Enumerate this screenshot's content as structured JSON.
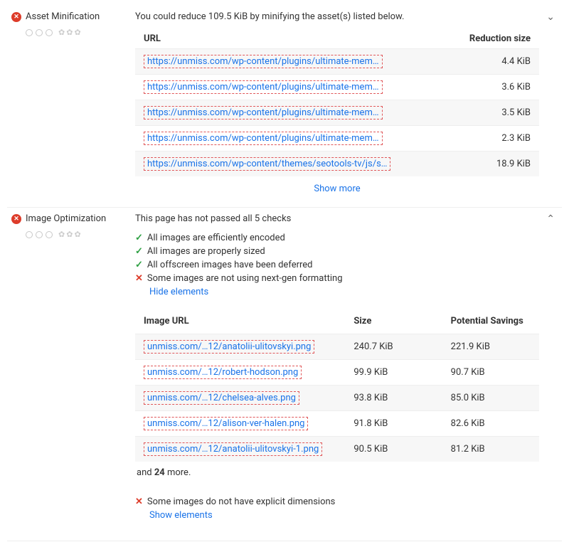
{
  "sections": {
    "minification": {
      "title": "Asset Minification",
      "summary": "You could reduce 109.5 KiB by minifying the asset(s) listed below.",
      "headers": {
        "url": "URL",
        "reduction": "Reduction size"
      },
      "rows": [
        {
          "url": "https://unmiss.com/wp-content/plugins/ultimate-mem…",
          "reduction": "4.4 KiB"
        },
        {
          "url": "https://unmiss.com/wp-content/plugins/ultimate-mem…",
          "reduction": "3.6 KiB"
        },
        {
          "url": "https://unmiss.com/wp-content/plugins/ultimate-mem…",
          "reduction": "3.5 KiB"
        },
        {
          "url": "https://unmiss.com/wp-content/plugins/ultimate-mem…",
          "reduction": "2.3 KiB"
        },
        {
          "url": "https://unmiss.com/wp-content/themes/seotools-tv/js/s…",
          "reduction": "18.9 KiB"
        }
      ],
      "show_more": "Show more"
    },
    "image_opt": {
      "title": "Image Optimization",
      "summary": "This page has not passed all 5 checks",
      "checks": [
        {
          "icon": "check",
          "text": "All images are efficiently encoded"
        },
        {
          "icon": "check",
          "text": "All images are properly sized"
        },
        {
          "icon": "check",
          "text": "All offscreen images have been deferred"
        },
        {
          "icon": "x",
          "text": "Some images are not using next-gen formatting"
        }
      ],
      "hide_elements": "Hide elements",
      "headers": {
        "url": "Image URL",
        "size": "Size",
        "savings": "Potential Savings"
      },
      "rows": [
        {
          "url": "unmiss.com/…12/anatolii-ulitovskyi.png",
          "size": "240.7 KiB",
          "savings": "221.9 KiB"
        },
        {
          "url": "unmiss.com/…12/robert-hodson.png",
          "size": "99.9 KiB",
          "savings": "90.7 KiB"
        },
        {
          "url": "unmiss.com/…12/chelsea-alves.png",
          "size": "93.8 KiB",
          "savings": "85.0 KiB"
        },
        {
          "url": "unmiss.com/…12/alison-ver-halen.png",
          "size": "91.8 KiB",
          "savings": "82.6 KiB"
        },
        {
          "url": "unmiss.com/…12/anatolii-ulitovskyi-1.png",
          "size": "90.5 KiB",
          "savings": "81.2 KiB"
        }
      ],
      "and_more_prefix": "and ",
      "and_more_count": "24",
      "and_more_suffix": " more.",
      "bottom_check": {
        "icon": "x",
        "text": "Some images do not have explicit dimensions"
      },
      "show_elements": "Show elements"
    }
  }
}
